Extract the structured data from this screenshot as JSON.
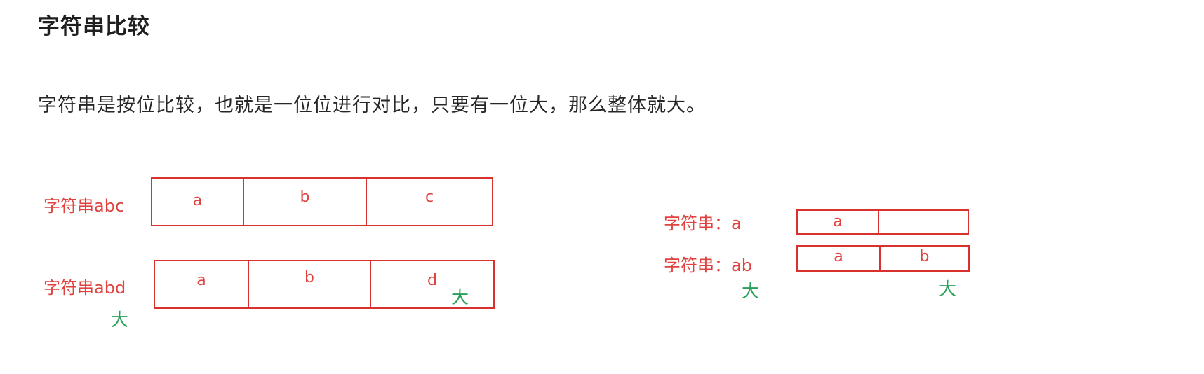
{
  "heading": "字符串比较",
  "paragraph": "字符串是按位比较，也就是一位位进行对比，只要有一位大，那么整体就大。",
  "example1": {
    "label_abc": "字符串abc",
    "label_abd": "字符串abd",
    "cells_abc": [
      "a",
      "b",
      "c"
    ],
    "cells_abd": [
      "a",
      "b",
      "d"
    ],
    "big_label": "大",
    "big_cell": "大"
  },
  "example2": {
    "label_a": "字符串：a",
    "label_ab": "字符串：ab",
    "cells_a": [
      "a",
      ""
    ],
    "cells_ab": [
      "a",
      "b"
    ],
    "big_label": "大",
    "big_cell": "大"
  },
  "colors": {
    "box_border": "#d9322e",
    "red_text": "#e0433f",
    "green_text": "#2aa05a"
  }
}
